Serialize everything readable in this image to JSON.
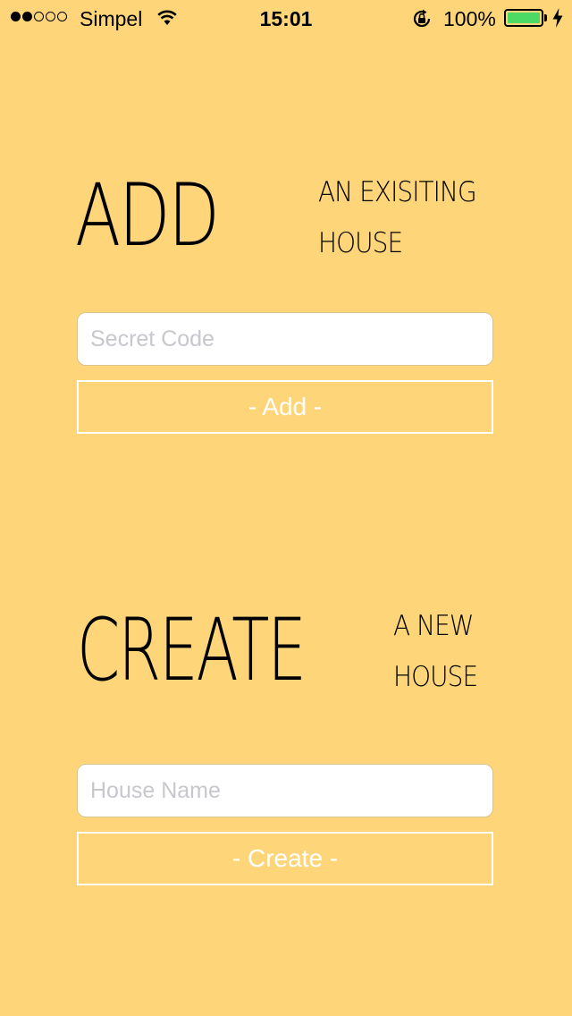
{
  "status_bar": {
    "carrier": "Simpel",
    "time": "15:01",
    "battery_percent": "100%",
    "signal_strength_dots": 2,
    "signal_total_dots": 5,
    "battery_level": 1.0,
    "battery_color": "#4CD964"
  },
  "add_section": {
    "heading": "ADD",
    "subheading_line1": "AN EXISITING",
    "subheading_line2": "HOUSE",
    "input_placeholder": "Secret Code",
    "button_label": "- Add -"
  },
  "create_section": {
    "heading": "CREATE",
    "subheading_line1": "A NEW",
    "subheading_line2": "HOUSE",
    "input_placeholder": "House Name",
    "button_label": "- Create -"
  },
  "colors": {
    "background": "#FED679",
    "button_border": "#FFFFFF",
    "input_background": "#FFFFFF"
  }
}
